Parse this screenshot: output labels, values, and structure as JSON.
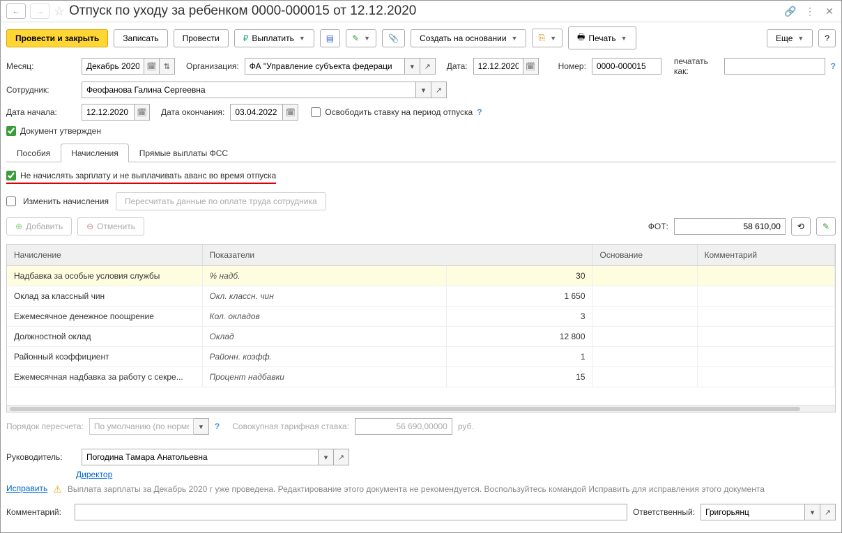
{
  "title": "Отпуск по уходу за ребенком 0000-000015 от 12.12.2020",
  "toolbar": {
    "post_close": "Провести и закрыть",
    "save": "Записать",
    "post": "Провести",
    "pay": "Выплатить",
    "create_based": "Создать на основании",
    "print": "Печать",
    "more": "Еще"
  },
  "fields": {
    "month_label": "Месяц:",
    "month_value": "Декабрь 2020",
    "org_label": "Организация:",
    "org_value": "ФА \"Управление субъекта федераци",
    "date_label": "Дата:",
    "date_value": "12.12.2020",
    "number_label": "Номер:",
    "number_value": "0000-000015",
    "print_as_label": "печатать как:",
    "employee_label": "Сотрудник:",
    "employee_value": "Феофанова Галина Сергеевна",
    "start_label": "Дата начала:",
    "start_value": "12.12.2020",
    "end_label": "Дата окончания:",
    "end_value": "03.04.2022",
    "release_rate": "Освободить ставку на период отпуска",
    "approved": "Документ утвержден"
  },
  "tabs": [
    "Пособия",
    "Начисления",
    "Прямые выплаты ФСС"
  ],
  "accruals": {
    "no_salary": "Не начислять зарплату и не выплачивать аванс во время отпуска",
    "change_accruals": "Изменить начисления",
    "recalc": "Пересчитать данные по оплате труда сотрудника",
    "add": "Добавить",
    "cancel": "Отменить",
    "fot_label": "ФОТ:",
    "fot_value": "58 610,00",
    "headers": [
      "Начисление",
      "Показатели",
      "Основание",
      "Комментарий"
    ],
    "rows": [
      {
        "name": "Надбавка за особые условия службы",
        "ind": "% надб.",
        "val": "30"
      },
      {
        "name": "Оклад за классный чин",
        "ind": "Окл. классн. чин",
        "val": "1 650"
      },
      {
        "name": "Ежемесячное денежное поощрение",
        "ind": "Кол. окладов",
        "val": "3"
      },
      {
        "name": "Должностной оклад",
        "ind": "Оклад",
        "val": "12 800"
      },
      {
        "name": "Районный коэффициент",
        "ind": "Районн. коэфф.",
        "val": "1"
      },
      {
        "name": "Ежемесячная надбавка за работу с секре...",
        "ind": "Процент надбавки",
        "val": "15"
      }
    ],
    "recalc_order_label": "Порядок пересчета:",
    "recalc_order_value": "По умолчанию (по норме",
    "tariff_label": "Совокупная тарифная ставка:",
    "tariff_value": "56 690,00000",
    "tariff_unit": "руб."
  },
  "footer": {
    "manager_label": "Руководитель:",
    "manager_value": "Погодина Тамара Анатольевна",
    "position": "Директор",
    "correct": "Исправить",
    "warning": "Выплата зарплаты за Декабрь 2020 г уже проведена. Редактирование этого документа не рекомендуется. Воспользуйтесь командой Исправить для исправления этого документа",
    "comment_label": "Комментарий:",
    "responsible_label": "Ответственный:",
    "responsible_value": "Григорьянц"
  }
}
